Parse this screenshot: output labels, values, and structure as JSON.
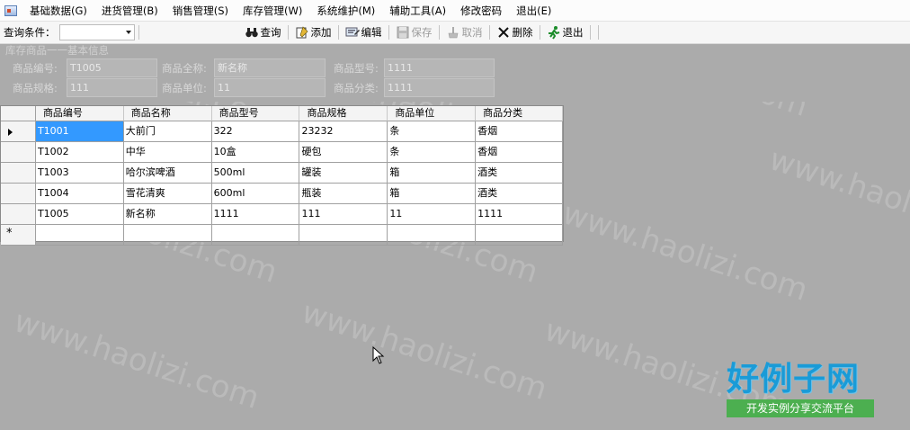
{
  "menubar": {
    "items": [
      "基础数据(G)",
      "进货管理(B)",
      "销售管理(S)",
      "库存管理(W)",
      "系统维护(M)",
      "辅助工具(A)",
      "修改密码",
      "退出(E)"
    ]
  },
  "toolbar": {
    "query_label": "查询条件：",
    "query_combo_value": "",
    "query_text_value": "",
    "buttons": {
      "query": "查询",
      "add": "添加",
      "edit": "编辑",
      "save": "保存",
      "cancel": "取消",
      "delete": "删除",
      "exit": "退出"
    },
    "icons": {
      "query": "binoculars-icon",
      "add": "add-icon",
      "edit": "edit-icon",
      "save": "save-icon",
      "cancel": "cancel-icon",
      "delete": "delete-icon",
      "exit": "exit-icon"
    }
  },
  "details": {
    "title": "库存商品一一基本信息",
    "code_label": "商品编号:",
    "code_value": "T1005",
    "fullname_label": "商品全称:",
    "fullname_value": "新名称",
    "model_label": "商品型号:",
    "model_value": "1111",
    "spec_label": "商品规格:",
    "spec_value": "111",
    "unit_label": "商品单位:",
    "unit_value": "11",
    "category_label": "商品分类:",
    "category_value": "1111"
  },
  "grid": {
    "columns": [
      "商品编号",
      "商品名称",
      "商品型号",
      "商品规格",
      "商品单位",
      "商品分类"
    ],
    "rows": [
      [
        "T1001",
        "大前门",
        "322",
        "23232",
        "条",
        "香烟"
      ],
      [
        "T1002",
        "中华",
        "10盒",
        "硬包",
        "条",
        "香烟"
      ],
      [
        "T1003",
        "哈尔滨啤酒",
        "500ml",
        "罐装",
        "箱",
        "酒类"
      ],
      [
        "T1004",
        "雪花清爽",
        "600ml",
        "瓶装",
        "箱",
        "酒类"
      ],
      [
        "T1005",
        "新名称",
        "1111",
        "111",
        "11",
        "1111"
      ]
    ],
    "new_row_marker": "*"
  },
  "watermark_text": "www.haolizi.com",
  "brand": {
    "title": "好例子网",
    "subtitle": "开发实例分享交流平台"
  },
  "colors": {
    "selection": "#3399ff",
    "background": "#ababab",
    "brand_blue": "#1a9bd7",
    "brand_green": "#4caf50"
  }
}
